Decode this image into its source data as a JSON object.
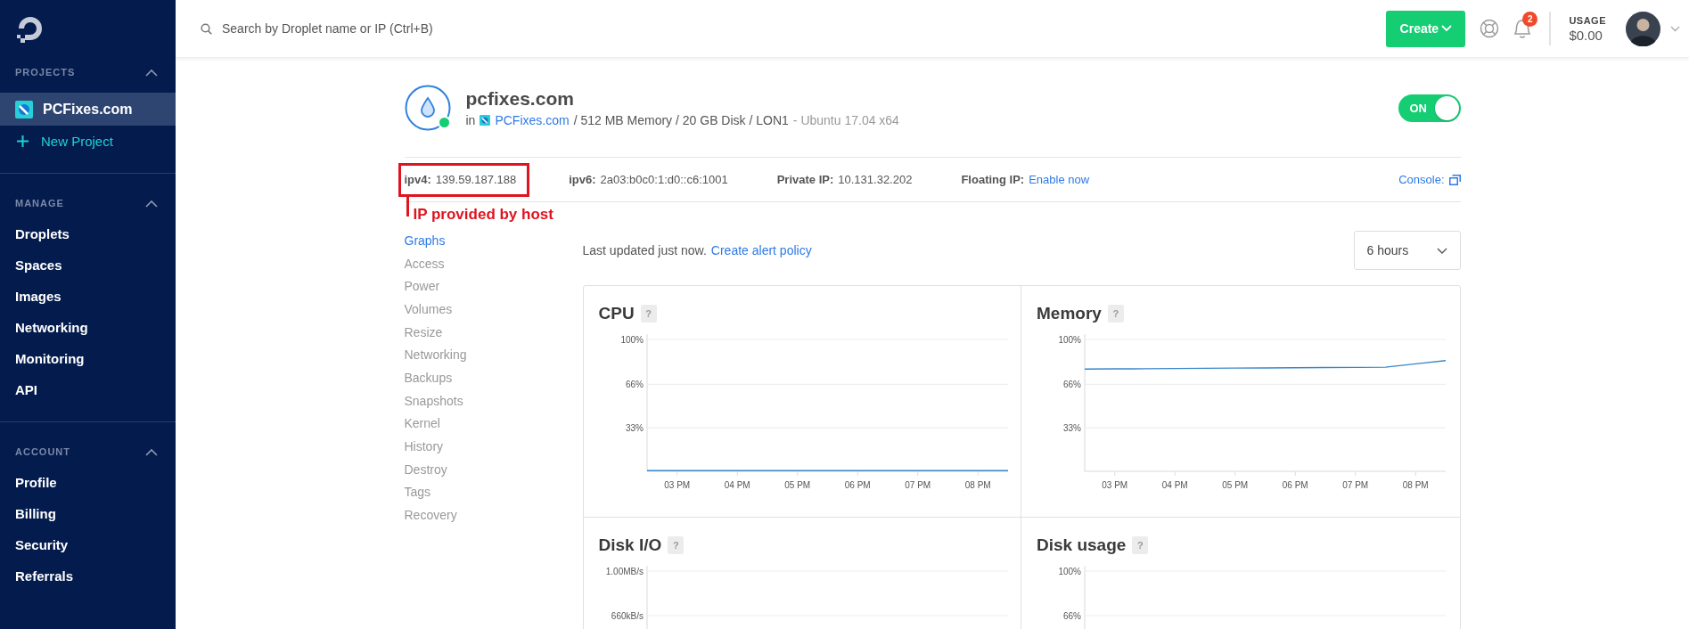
{
  "sidebar": {
    "sections": [
      {
        "label": "PROJECTS",
        "expanded": true,
        "items": [
          {
            "label": "PCFixes.com",
            "kind": "project",
            "selected": true
          },
          {
            "label": "New Project",
            "kind": "add",
            "selected": false
          }
        ]
      },
      {
        "label": "MANAGE",
        "expanded": true,
        "items": [
          {
            "label": "Droplets",
            "kind": "link",
            "selected": false
          },
          {
            "label": "Spaces",
            "kind": "link",
            "selected": false
          },
          {
            "label": "Images",
            "kind": "link",
            "selected": false
          },
          {
            "label": "Networking",
            "kind": "link",
            "selected": false
          },
          {
            "label": "Monitoring",
            "kind": "link",
            "selected": false
          },
          {
            "label": "API",
            "kind": "link",
            "selected": false
          }
        ]
      },
      {
        "label": "ACCOUNT",
        "expanded": true,
        "items": [
          {
            "label": "Profile",
            "kind": "link",
            "selected": false
          },
          {
            "label": "Billing",
            "kind": "link",
            "selected": false
          },
          {
            "label": "Security",
            "kind": "link",
            "selected": false
          },
          {
            "label": "Referrals",
            "kind": "link",
            "selected": false
          }
        ]
      }
    ]
  },
  "topbar": {
    "search": {
      "placeholder": "Search by Droplet name or IP (Ctrl+B)"
    },
    "create_button": "Create",
    "notifications": "2",
    "usage_label": "USAGE",
    "usage_amount": "$0.00"
  },
  "droplet": {
    "name": "pcfixes.com",
    "online": true,
    "prefix": "in",
    "project": "PCFixes.com",
    "specs": "/ 512 MB Memory / 20 GB Disk / LON1",
    "image": "- Ubuntu 17.04 x64",
    "power": {
      "label": "ON",
      "on": true
    }
  },
  "network": [
    {
      "label": "ipv4:",
      "value": "139.59.187.188",
      "kind": "text",
      "annotated": true
    },
    {
      "label": "ipv6:",
      "value": "2a03:b0c0:1:d0::c6:1001",
      "kind": "text",
      "annotated": false
    },
    {
      "label": "Private IP:",
      "value": "10.131.32.202",
      "kind": "text",
      "annotated": false
    },
    {
      "label": "Floating IP:",
      "value": "Enable now",
      "kind": "link",
      "annotated": false
    }
  ],
  "console": "Console:",
  "annotation": "IP provided by host",
  "tabs": [
    {
      "label": "Graphs",
      "selected": true
    },
    {
      "label": "Access",
      "selected": false
    },
    {
      "label": "Power",
      "selected": false
    },
    {
      "label": "Volumes",
      "selected": false
    },
    {
      "label": "Resize",
      "selected": false
    },
    {
      "label": "Networking",
      "selected": false
    },
    {
      "label": "Backups",
      "selected": false
    },
    {
      "label": "Snapshots",
      "selected": false
    },
    {
      "label": "Kernel",
      "selected": false
    },
    {
      "label": "History",
      "selected": false
    },
    {
      "label": "Destroy",
      "selected": false
    },
    {
      "label": "Tags",
      "selected": false
    },
    {
      "label": "Recovery",
      "selected": false
    }
  ],
  "last_updated": "Last updated just now.",
  "alert_link": "Create alert policy",
  "range": "6 hours",
  "charts": [
    {
      "title": "CPU",
      "help": "?",
      "chart_data": {
        "type": "line",
        "categories": [
          null,
          "03 PM",
          null,
          "04 PM",
          null,
          "05 PM",
          null,
          "06 PM",
          null,
          "07 PM",
          null,
          "08 PM",
          null
        ],
        "series": [
          {
            "color": "#3a87c8",
            "values": [
              0.5,
              0.5,
              0.5,
              0.5,
              0.5,
              0.5,
              0.5,
              0.5,
              0.5,
              0.5,
              0.5,
              0.5,
              0.5
            ]
          }
        ],
        "ylim": [
          0,
          100
        ],
        "yticks": [
          {
            "value": 100,
            "label": "100%"
          },
          {
            "value": 66,
            "label": "66%"
          },
          {
            "value": 33,
            "label": "33%"
          }
        ]
      }
    },
    {
      "title": "Memory",
      "help": "?",
      "chart_data": {
        "type": "line",
        "categories": [
          null,
          "03 PM",
          null,
          "04 PM",
          null,
          "05 PM",
          null,
          "06 PM",
          null,
          "07 PM",
          null,
          "08 PM",
          null
        ],
        "series": [
          {
            "color": "#3a87c8",
            "values": [
              77.5,
              77.7,
              77.8,
              78,
              78.1,
              78.3,
              78.4,
              78.6,
              78.7,
              78.8,
              79,
              81.5,
              84
            ]
          }
        ],
        "ylim": [
          0,
          100
        ],
        "yticks": [
          {
            "value": 100,
            "label": "100%"
          },
          {
            "value": 66,
            "label": "66%"
          },
          {
            "value": 33,
            "label": "33%"
          }
        ]
      }
    },
    {
      "title": "Disk I/O",
      "help": "?",
      "axis_labels": [
        "1.00MB/s",
        "660kB/s"
      ]
    },
    {
      "title": "Disk usage",
      "help": "?",
      "axis_labels": [
        "100%",
        "66%"
      ]
    }
  ]
}
